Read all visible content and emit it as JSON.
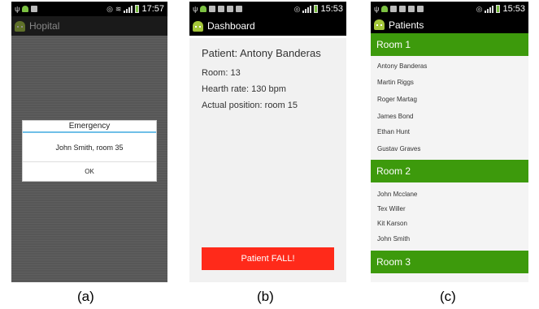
{
  "screen_a": {
    "time": "17:57",
    "app_title": "Hopital",
    "dialog": {
      "title": "Emergency",
      "message": "John Smith, room 35",
      "ok_label": "OK"
    }
  },
  "screen_b": {
    "time": "15:53",
    "app_title": "Dashboard",
    "patient_name": "Patient: Antony Banderas",
    "room": "Room: 13",
    "heart_rate": "Hearth rate: 130 bpm",
    "position": "Actual position: room 15",
    "fall_button": "Patient FALL!"
  },
  "screen_c": {
    "time": "15:53",
    "app_title": "Patients",
    "rooms": [
      {
        "name": "Room 1",
        "patients": [
          "Antony Banderas",
          "Martin Riggs",
          "Roger Martag",
          "James Bond",
          "Ethan Hunt",
          "Gustav Graves"
        ]
      },
      {
        "name": "Room 2",
        "patients": [
          "John Mcclane",
          "Tex Willer",
          "Kit Karson",
          "John Smith"
        ]
      },
      {
        "name": "Room 3",
        "patients": []
      }
    ]
  },
  "captions": [
    "(a)",
    "(b)",
    "(c)"
  ],
  "colors": {
    "room_header": "#3d9a0c",
    "fall_button": "#ff2a1a",
    "dialog_divider": "#6fbfe8"
  }
}
